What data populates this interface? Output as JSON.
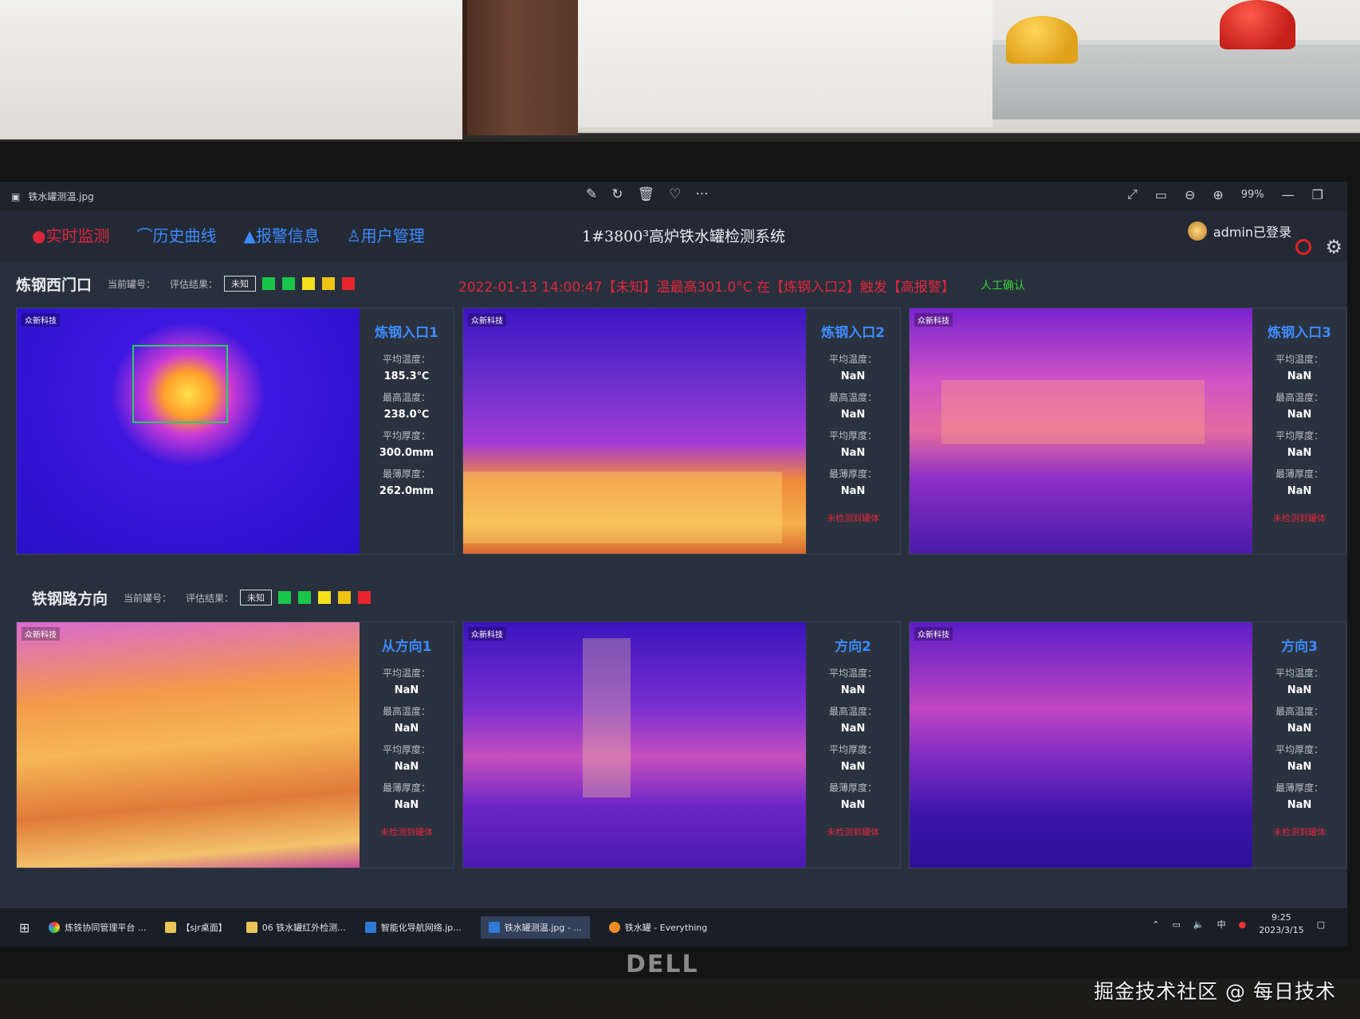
{
  "viewer": {
    "filename": "铁水罐测温.jpg",
    "zoom": "99%",
    "icons": [
      "edit-icon",
      "rotate-icon",
      "delete-icon",
      "heart-icon",
      "more-icon"
    ]
  },
  "nav": {
    "items": [
      {
        "label": "实时监测"
      },
      {
        "label": "历史曲线"
      },
      {
        "label": "报警信息"
      },
      {
        "label": "用户管理"
      }
    ]
  },
  "app": {
    "title": "1#3800³高炉铁水罐检测系统",
    "user": "admin已登录"
  },
  "section1": {
    "name": "炼钢西门口",
    "current_label": "当前罐号：",
    "result_label": "评估结果：",
    "result_value": "未知",
    "alert": "2022-01-13 14:00:47【未知】温最高301.0°C 在【炼钢入口2】触发【高报警】",
    "confirm": "人工确认"
  },
  "section2": {
    "name": "铁钢路方向",
    "current_label": "当前罐号：",
    "result_label": "评估结果：",
    "result_value": "未知"
  },
  "swatch_colors": [
    "#19c64a",
    "#19c64a",
    "#f3e21b",
    "#f0c415",
    "#e8252e"
  ],
  "labels": {
    "avg_temp": "平均温度：",
    "max_temp": "最高温度：",
    "avg_thick": "平均厚度：",
    "min_thick": "最薄厚度："
  },
  "logo_text": "众新科技",
  "cameras_row1": [
    {
      "name": "炼钢入口1",
      "avg_temp": "185.3℃",
      "max_temp": "238.0℃",
      "avg_thick": "300.0mm",
      "min_thick": "262.0mm",
      "status": ""
    },
    {
      "name": "炼钢入口2",
      "avg_temp": "NaN",
      "max_temp": "NaN",
      "avg_thick": "NaN",
      "min_thick": "NaN",
      "status": "未检测到罐体"
    },
    {
      "name": "炼钢入口3",
      "avg_temp": "NaN",
      "max_temp": "NaN",
      "avg_thick": "NaN",
      "min_thick": "NaN",
      "status": "未检测到罐体"
    }
  ],
  "cameras_row2": [
    {
      "name": "从方向1",
      "avg_temp": "NaN",
      "max_temp": "NaN",
      "avg_thick": "NaN",
      "min_thick": "NaN",
      "status": "未检测到罐体"
    },
    {
      "name": "方向2",
      "avg_temp": "NaN",
      "max_temp": "NaN",
      "avg_thick": "NaN",
      "min_thick": "NaN",
      "status": "未检测到罐体"
    },
    {
      "name": "方向3",
      "avg_temp": "NaN",
      "max_temp": "NaN",
      "avg_thick": "NaN",
      "min_thick": "NaN",
      "status": "未检测到罐体"
    }
  ],
  "taskbar": {
    "items": [
      {
        "label": "炼铁协同管理平台 ..."
      },
      {
        "label": "【sjr桌面】"
      },
      {
        "label": "06 铁水罐红外检测..."
      },
      {
        "label": "智能化导航网络.jp..."
      },
      {
        "label": "铁水罐测温.jpg - ..."
      },
      {
        "label": "铁水罐 - Everything"
      }
    ],
    "ime": "中",
    "time": "9:25",
    "date": "2023/3/15"
  },
  "photo_watermark": "掘金技术社区 @ 每日技术"
}
